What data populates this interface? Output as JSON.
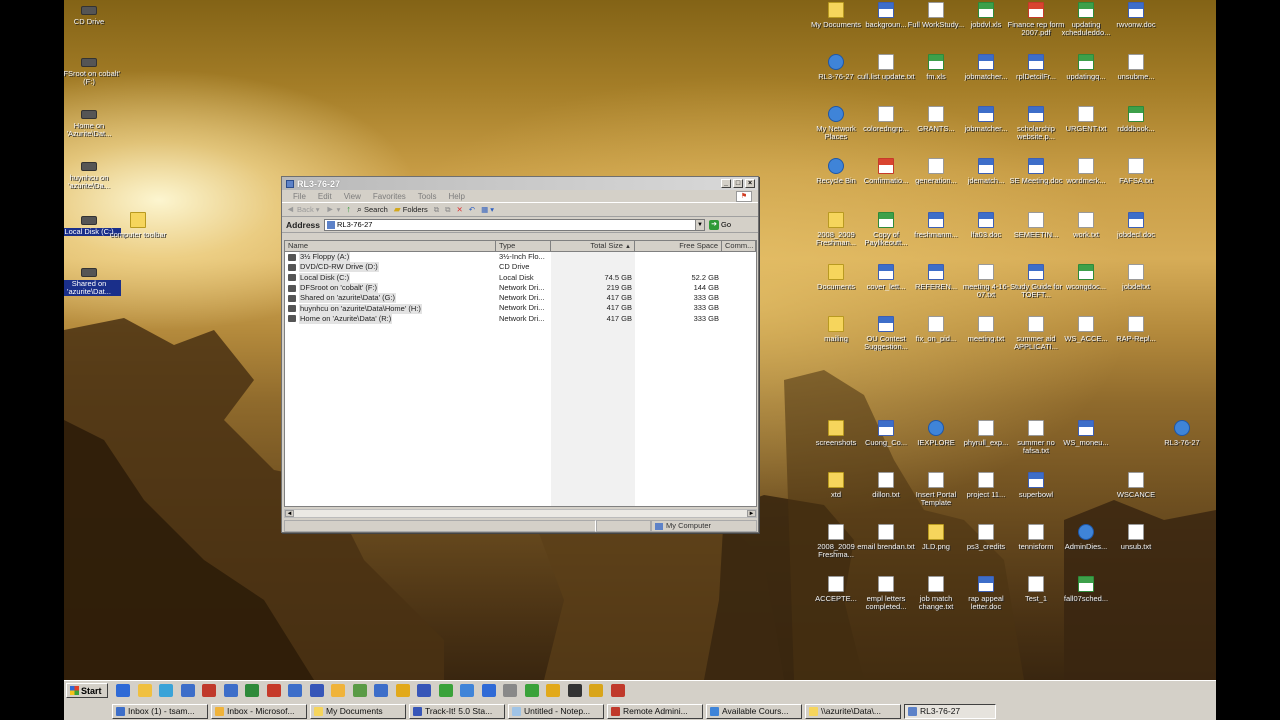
{
  "desktop_left_icons": [
    {
      "label": "CD Drive",
      "glyph": "drive-icon"
    },
    {
      "label": "DFSroot on cobalt' (F:)",
      "glyph": "network-drive-icon"
    },
    {
      "label": "Home on 'Azurite\\Dat...",
      "glyph": "network-drive-icon"
    },
    {
      "label": "huynhcu on 'azurite\\Da...",
      "glyph": "network-drive-icon"
    },
    {
      "label": "Local Disk (C:)",
      "glyph": "drive-icon",
      "selected": true
    },
    {
      "label": "Shared on 'azurite\\Dat...",
      "glyph": "network-drive-icon",
      "selected": true
    },
    {
      "label": "computer toolbar",
      "glyph": "folder-icon"
    }
  ],
  "desktop_right_icons": [
    {
      "label": "My Documents",
      "glyph": "folder-icon"
    },
    {
      "label": "backgroun...",
      "glyph": "word-icon"
    },
    {
      "label": "Full WorkStudy...",
      "glyph": "text-icon"
    },
    {
      "label": "jobdvl.xls",
      "glyph": "excel-icon"
    },
    {
      "label": "Finance rep form 2007.pdf",
      "glyph": "pdf-icon"
    },
    {
      "label": "updating xcheduleddo...",
      "glyph": "excel-icon"
    },
    {
      "label": "rwvonw.doc",
      "glyph": "word-icon"
    },
    {
      "label": "RL3-76-27",
      "glyph": "computer-icon"
    },
    {
      "label": "cull.list update.txt",
      "glyph": "text-icon"
    },
    {
      "label": "fm.xls",
      "glyph": "excel-icon"
    },
    {
      "label": "jobmatcher...",
      "glyph": "pub-icon"
    },
    {
      "label": "rplDetcilFr...",
      "glyph": "pub-icon"
    },
    {
      "label": "updatingq...",
      "glyph": "excel-icon"
    },
    {
      "label": "unsubme...",
      "glyph": "text-icon"
    },
    {
      "label": "My Network Places",
      "glyph": "network-icon"
    },
    {
      "label": "coloredngrp...",
      "glyph": "text-icon"
    },
    {
      "label": "GRANTS...",
      "glyph": "text-icon"
    },
    {
      "label": "jobmatcher...",
      "glyph": "pub-icon"
    },
    {
      "label": "scholarship website.p...",
      "glyph": "pub-icon"
    },
    {
      "label": "URGENT.txt",
      "glyph": "text-icon"
    },
    {
      "label": "rdddbook...",
      "glyph": "excel-icon"
    },
    {
      "label": "Recycle Bin",
      "glyph": "recycle-icon"
    },
    {
      "label": "Confirmatio...",
      "glyph": "pdf-icon"
    },
    {
      "label": "generation...",
      "glyph": "text-icon"
    },
    {
      "label": "jdematch...",
      "glyph": "word-icon"
    },
    {
      "label": "SE Meeting.doc",
      "glyph": "word-icon"
    },
    {
      "label": "wordmerk...",
      "glyph": "text-icon"
    },
    {
      "label": "FAFSA.txt",
      "glyph": "text-icon"
    },
    {
      "label": "2008_2009 Freshman...",
      "glyph": "folder-icon"
    },
    {
      "label": "Copy of Paylikeoutt...",
      "glyph": "excel-icon"
    },
    {
      "label": "freshmanm...",
      "glyph": "word-icon"
    },
    {
      "label": "lfa03.doc",
      "glyph": "word-icon"
    },
    {
      "label": "SEMEETIN...",
      "glyph": "text-icon"
    },
    {
      "label": "work.txt",
      "glyph": "text-icon"
    },
    {
      "label": "jobdecl.doc",
      "glyph": "word-icon"
    },
    {
      "label": "Documents",
      "glyph": "folder-icon"
    },
    {
      "label": "cover_lett...",
      "glyph": "word-icon"
    },
    {
      "label": "REFEREN...",
      "glyph": "word-icon"
    },
    {
      "label": "meeting 4-16-07.txt",
      "glyph": "text-icon"
    },
    {
      "label": "Study Guide for TOEFT...",
      "glyph": "word-icon"
    },
    {
      "label": "wcongdoc...",
      "glyph": "excel-icon"
    },
    {
      "label": "jobdeltxt",
      "glyph": "text-icon"
    },
    {
      "label": "mailing",
      "glyph": "folder-icon"
    },
    {
      "label": "OU Contest Suggestion...",
      "glyph": "word-icon"
    },
    {
      "label": "fix_on_pid...",
      "glyph": "text-icon"
    },
    {
      "label": "meeting.txt",
      "glyph": "text-icon"
    },
    {
      "label": "summer aid APPLICATI...",
      "glyph": "text-icon"
    },
    {
      "label": "WS_ACCE...",
      "glyph": "text-icon"
    },
    {
      "label": "RAP-Repl...",
      "glyph": "text-icon"
    },
    {
      "label": "screenshots",
      "glyph": "folder-icon"
    },
    {
      "label": "Cuong_Co...",
      "glyph": "word-icon"
    },
    {
      "label": "IEXPLORE",
      "glyph": "ie-icon"
    },
    {
      "label": "phyrull_exp...",
      "glyph": "text-icon"
    },
    {
      "label": "summer no fafsa.txt",
      "glyph": "text-icon"
    },
    {
      "label": "WS_moneu...",
      "glyph": "word-icon"
    },
    {
      "label": "RL3-76-27",
      "glyph": "computer-icon"
    },
    {
      "label": "xtd",
      "glyph": "folder-icon"
    },
    {
      "label": "dillon.txt",
      "glyph": "text-icon"
    },
    {
      "label": "Insert Portal Template",
      "glyph": "window-icon"
    },
    {
      "label": "project 11...",
      "glyph": "text-icon"
    },
    {
      "label": "superbowl",
      "glyph": "word-icon"
    },
    {
      "label": "WSCANCE",
      "glyph": "text-icon"
    },
    {
      "label": "2008_2009 Freshma...",
      "glyph": "text-icon"
    },
    {
      "label": "email brendan.txt",
      "glyph": "text-icon"
    },
    {
      "label": "JLD.png",
      "glyph": "image-icon"
    },
    {
      "label": "ps3_credits",
      "glyph": "text-icon"
    },
    {
      "label": "tennisform",
      "glyph": "text-icon"
    },
    {
      "label": "AdminDies...",
      "glyph": "app-icon"
    },
    {
      "label": "unsub.txt",
      "glyph": "text-icon"
    },
    {
      "label": "ACCEPTE...",
      "glyph": "text-icon"
    },
    {
      "label": "empl letters completed...",
      "glyph": "text-icon"
    },
    {
      "label": "job match change.txt",
      "glyph": "text-icon"
    },
    {
      "label": "rap appeal letter.doc",
      "glyph": "word-icon"
    },
    {
      "label": "Test_1",
      "glyph": "text-icon"
    },
    {
      "label": "fall07sched...",
      "glyph": "excel-icon"
    }
  ],
  "window": {
    "title": "RL3-76-27",
    "menu": [
      "File",
      "Edit",
      "View",
      "Favorites",
      "Tools",
      "Help"
    ],
    "toolbar": {
      "back": "Back",
      "search": "Search",
      "folders": "Folders"
    },
    "address_label": "Address",
    "address_value": "RL3-76-27",
    "go_label": "Go",
    "columns": [
      "Name",
      "Type",
      "Total Size",
      "Free Space",
      "Comm..."
    ],
    "rows": [
      {
        "name": "3½ Floppy (A:)",
        "type": "3½-Inch Flo...",
        "total": "",
        "free": ""
      },
      {
        "name": "DVD/CD-RW Drive (D:)",
        "type": "CD Drive",
        "total": "",
        "free": ""
      },
      {
        "name": "Local Disk (C:)",
        "type": "Local Disk",
        "total": "74.5 GB",
        "free": "52.2 GB"
      },
      {
        "name": "DFSroot on 'cobalt' (F:)",
        "type": "Network Dri...",
        "total": "219 GB",
        "free": "144 GB"
      },
      {
        "name": "Shared on 'azurite\\Data' (G:)",
        "type": "Network Dri...",
        "total": "417 GB",
        "free": "333 GB"
      },
      {
        "name": "huynhcu on 'azurite\\Data\\Home' (H:)",
        "type": "Network Dri...",
        "total": "417 GB",
        "free": "333 GB"
      },
      {
        "name": "Home on 'Azurite\\Data' (R:)",
        "type": "Network Dri...",
        "total": "417 GB",
        "free": "333 GB"
      }
    ],
    "status_zone": "My Computer"
  },
  "taskbar": {
    "start": "Start",
    "tasks": [
      {
        "label": "Inbox (1) - tsam...",
        "color": "#3d6ec9"
      },
      {
        "label": "Inbox - Microsof...",
        "color": "#f0b33a"
      },
      {
        "label": "My Documents",
        "color": "#f6d55c"
      },
      {
        "label": "Track-It! 5.0 Sta...",
        "color": "#3756b8"
      },
      {
        "label": "Untitled - Notep...",
        "color": "#9fc3e6"
      },
      {
        "label": "Remote Admini...",
        "color": "#c0392b"
      },
      {
        "label": "Available Cours...",
        "color": "#3f84d8"
      },
      {
        "label": "\\\\azurite\\Data\\...",
        "color": "#f6d55c"
      },
      {
        "label": "RL3-76-27",
        "color": "#5d82c8",
        "active": true
      }
    ]
  },
  "colors": {
    "wallpaper_light": "#d6ac57",
    "wallpaper_dark": "#2e1e0c",
    "selection": "#1a2f8a",
    "chrome": "#d4d0c8"
  }
}
